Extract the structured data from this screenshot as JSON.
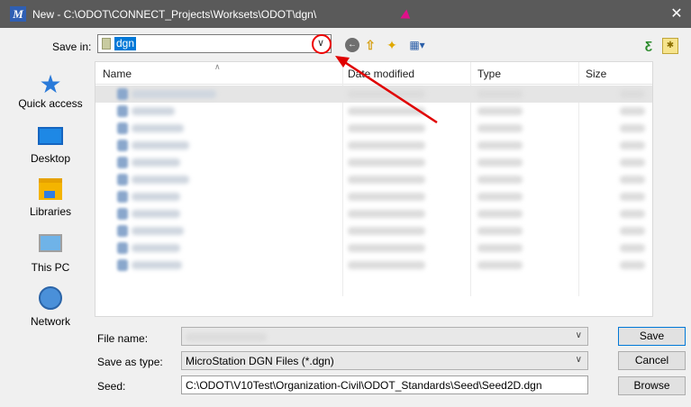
{
  "window": {
    "title": "New - C:\\ODOT\\CONNECT_Projects\\Worksets\\ODOT\\dgn\\",
    "app_icon": "M",
    "close": "✕"
  },
  "save_in": {
    "label": "Save in:",
    "value": "dgn"
  },
  "toolbar": {
    "back": "←",
    "up": "⇧",
    "new_folder": "✦",
    "views": "▦▾",
    "right1": "ƹ",
    "right2": "✱"
  },
  "places": [
    {
      "label": "Quick access",
      "icon": "quick-access-icon"
    },
    {
      "label": "Desktop",
      "icon": "desktop-icon"
    },
    {
      "label": "Libraries",
      "icon": "libraries-icon"
    },
    {
      "label": "This PC",
      "icon": "this-pc-icon"
    },
    {
      "label": "Network",
      "icon": "network-icon"
    }
  ],
  "file_list": {
    "columns": [
      "Name",
      "Date modified",
      "Type",
      "Size"
    ],
    "rows": [
      {
        "selected": true
      },
      {},
      {},
      {},
      {},
      {},
      {},
      {},
      {},
      {},
      {}
    ]
  },
  "file_name": {
    "label": "File name:",
    "value": ""
  },
  "save_as_type": {
    "label": "Save as type:",
    "value": "MicroStation DGN Files (*.dgn)"
  },
  "seed": {
    "label": "Seed:",
    "value": "C:\\ODOT\\V10Test\\Organization-Civil\\ODOT_Standards\\Seed\\Seed2D.dgn"
  },
  "buttons": {
    "save": "Save",
    "cancel": "Cancel",
    "browse": "Browse"
  },
  "colors": {
    "titlebar": "#5a5a5a",
    "selection": "#0078d7",
    "annotation": "#e00000"
  }
}
